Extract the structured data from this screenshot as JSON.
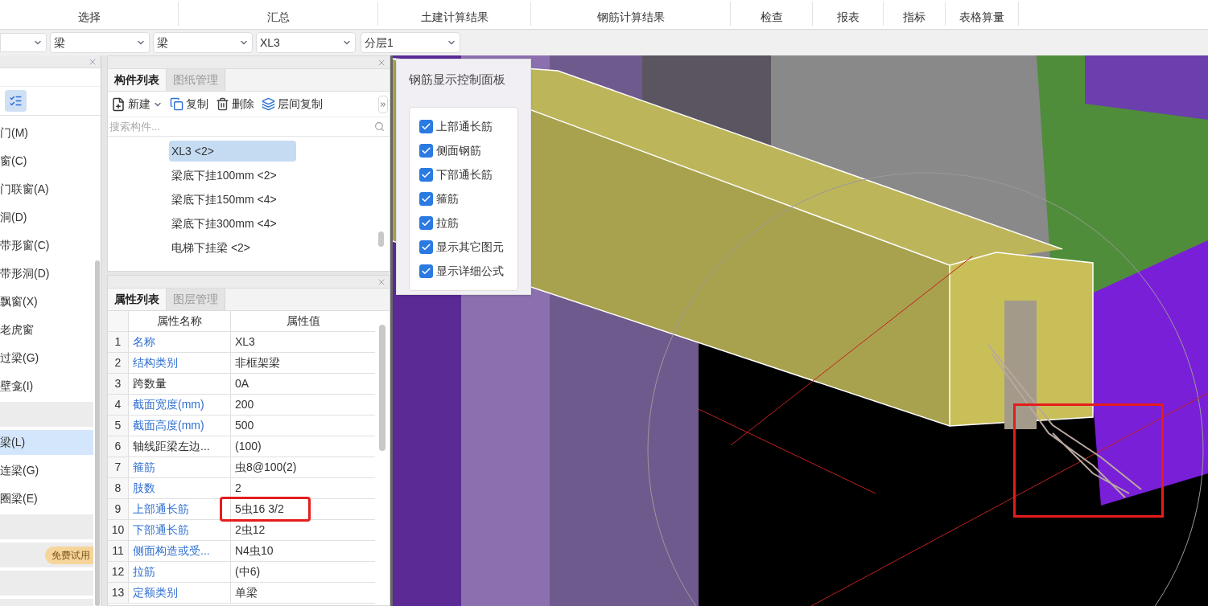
{
  "ribbon": {
    "groups": [
      {
        "label": "选择"
      },
      {
        "label": "汇总"
      },
      {
        "label": "土建计算结果"
      },
      {
        "label": "钢筋计算结果"
      },
      {
        "label": "检查"
      },
      {
        "label": "报表"
      },
      {
        "label": "指标"
      },
      {
        "label": "表格算量"
      }
    ]
  },
  "selectors": [
    {
      "value": "梁"
    },
    {
      "value": "梁"
    },
    {
      "value": "XL3"
    },
    {
      "value": "分层1"
    }
  ],
  "nav_panel": {
    "items": [
      {
        "kind": "item",
        "label": "门(M)",
        "selected": false
      },
      {
        "kind": "item",
        "label": "窗(C)",
        "selected": false
      },
      {
        "kind": "item",
        "label": "门联窗(A)",
        "selected": false
      },
      {
        "kind": "item",
        "label": "洞(D)",
        "selected": false
      },
      {
        "kind": "item",
        "label": "带形窗(C)",
        "selected": false
      },
      {
        "kind": "item",
        "label": "带形洞(D)",
        "selected": false
      },
      {
        "kind": "item",
        "label": "飘窗(X)",
        "selected": false
      },
      {
        "kind": "item",
        "label": "老虎窗",
        "selected": false
      },
      {
        "kind": "item",
        "label": "过梁(G)",
        "selected": false
      },
      {
        "kind": "item",
        "label": "壁龛(I)",
        "selected": false
      },
      {
        "kind": "group"
      },
      {
        "kind": "item",
        "label": "梁(L)",
        "selected": true
      },
      {
        "kind": "item",
        "label": "连梁(G)",
        "selected": false
      },
      {
        "kind": "item",
        "label": "圈梁(E)",
        "selected": false
      },
      {
        "kind": "group"
      },
      {
        "kind": "badge",
        "badge": "免费试用"
      },
      {
        "kind": "group"
      },
      {
        "kind": "group"
      }
    ]
  },
  "component_panel": {
    "tabs": [
      {
        "label": "构件列表",
        "selected": true
      },
      {
        "label": "图纸管理",
        "selected": false
      }
    ],
    "toolbar": [
      {
        "kind": "new",
        "label": "新建"
      },
      {
        "kind": "copy",
        "label": "复制"
      },
      {
        "kind": "delete",
        "label": "删除"
      },
      {
        "kind": "floor_copy",
        "label": "层间复制"
      }
    ],
    "search": {
      "placeholder": "搜索构件..."
    },
    "items": [
      {
        "label": "XL3 <2>",
        "selected": true
      },
      {
        "label": "梁底下挂100mm <2>",
        "selected": false
      },
      {
        "label": "梁底下挂150mm <4>",
        "selected": false
      },
      {
        "label": "梁底下挂300mm <4>",
        "selected": false
      },
      {
        "label": "电梯下挂梁 <2>",
        "selected": false
      }
    ]
  },
  "property_panel": {
    "tabs": [
      {
        "label": "属性列表",
        "selected": true
      },
      {
        "label": "图层管理",
        "selected": false
      }
    ],
    "columns": [
      "属性名称",
      "属性值"
    ],
    "rows": [
      {
        "index": "1",
        "name": "名称",
        "value": "XL3",
        "public": true,
        "highlighted": false
      },
      {
        "index": "2",
        "name": "结构类别",
        "value": "非框架梁",
        "public": true,
        "highlighted": false
      },
      {
        "index": "3",
        "name": "跨数量",
        "value": "0A",
        "public": false,
        "highlighted": false
      },
      {
        "index": "4",
        "name": "截面宽度(mm)",
        "value": "200",
        "public": true,
        "highlighted": false
      },
      {
        "index": "5",
        "name": "截面高度(mm)",
        "value": "500",
        "public": true,
        "highlighted": false
      },
      {
        "index": "6",
        "name": "轴线距梁左边...",
        "value": "(100)",
        "public": false,
        "highlighted": false
      },
      {
        "index": "7",
        "name": "箍筋",
        "value": "虫8@100(2)",
        "public": true,
        "highlighted": false
      },
      {
        "index": "8",
        "name": "肢数",
        "value": "2",
        "public": true,
        "highlighted": false
      },
      {
        "index": "9",
        "name": "上部通长筋",
        "value": "5虫16 3/2",
        "public": true,
        "highlighted": true
      },
      {
        "index": "10",
        "name": "下部通长筋",
        "value": "2虫12",
        "public": true,
        "highlighted": false
      },
      {
        "index": "11",
        "name": "侧面构造或受...",
        "value": "N4虫10",
        "public": true,
        "highlighted": false
      },
      {
        "index": "12",
        "name": "拉筋",
        "value": "(中6)",
        "public": true,
        "highlighted": false
      },
      {
        "index": "13",
        "name": "定额类别",
        "value": "单梁",
        "public": true,
        "highlighted": false
      }
    ]
  },
  "control_panel": {
    "title": "钢筋显示控制面板",
    "options": [
      {
        "label": "上部通长筋",
        "checked": true
      },
      {
        "label": "侧面钢筋",
        "checked": true
      },
      {
        "label": "下部通长筋",
        "checked": true
      },
      {
        "label": "箍筋",
        "checked": true
      },
      {
        "label": "拉筋",
        "checked": true
      },
      {
        "label": "显示其它图元",
        "checked": true
      },
      {
        "label": "显示详细公式",
        "checked": true
      }
    ]
  },
  "viewport": {
    "highlight": true
  }
}
